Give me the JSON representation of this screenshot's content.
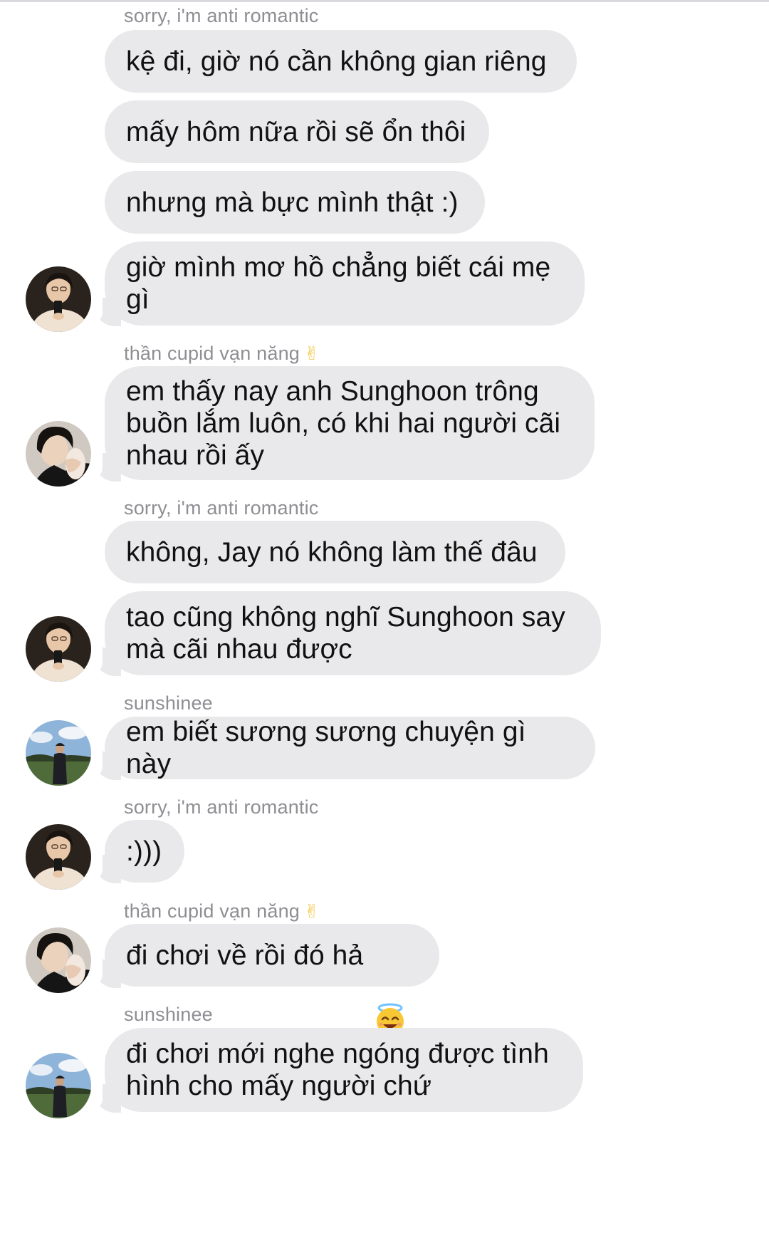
{
  "messages": [
    {
      "sender": "sorry, i'm anti romantic"
    },
    {
      "text": "kệ đi, giờ nó cần không gian riêng"
    },
    {
      "text": "mấy hôm nữa rồi sẽ ổn thôi"
    },
    {
      "text": "nhưng mà bực mình thật :)"
    },
    {
      "text": "giờ mình mơ hồ chẳng biết cái mẹ\ngì"
    },
    {
      "sender": "thần cupid vạn năng",
      "sender_emoji": "✌"
    },
    {
      "text": "em thấy nay anh Sunghoon trông\nbuồn lắm luôn, có khi hai người cãi\nnhau rồi ấy"
    },
    {
      "sender": "sorry, i'm anti romantic"
    },
    {
      "text": "không, Jay nó không làm thế đâu"
    },
    {
      "text": "tao cũng không nghĩ Sunghoon say\nmà cãi nhau được"
    },
    {
      "sender": "sunshinee"
    },
    {
      "text": "em biết sương sương chuyện gì này"
    },
    {
      "sender": "sorry, i'm anti romantic"
    },
    {
      "text": ":)))"
    },
    {
      "sender": "thần cupid vạn năng",
      "sender_emoji": "✌"
    },
    {
      "text": "đi chơi về rồi đó hả",
      "trailing_icon": "smiling-halo-emoji-icon"
    },
    {
      "sender": "sunshinee"
    },
    {
      "text": "đi chơi mới nghe ngóng được tình\nhình cho mấy người chứ"
    }
  ],
  "avatars": [
    {
      "name": "avatar-anti-romantic",
      "icon": "mirror-selfie-avatar"
    },
    {
      "name": "avatar-cupid",
      "icon": "portrait-avatar"
    },
    {
      "name": "avatar-anti-romantic",
      "icon": "mirror-selfie-avatar"
    },
    {
      "name": "avatar-sunshinee",
      "icon": "outdoor-photo-avatar"
    },
    {
      "name": "avatar-anti-romantic",
      "icon": "mirror-selfie-avatar"
    },
    {
      "name": "avatar-cupid",
      "icon": "portrait-avatar"
    },
    {
      "name": "avatar-sunshinee",
      "icon": "outdoor-photo-avatar"
    }
  ],
  "colors": {
    "bubble": "#e9e9eb",
    "sender_label": "#8e8e93",
    "text": "#111111"
  }
}
